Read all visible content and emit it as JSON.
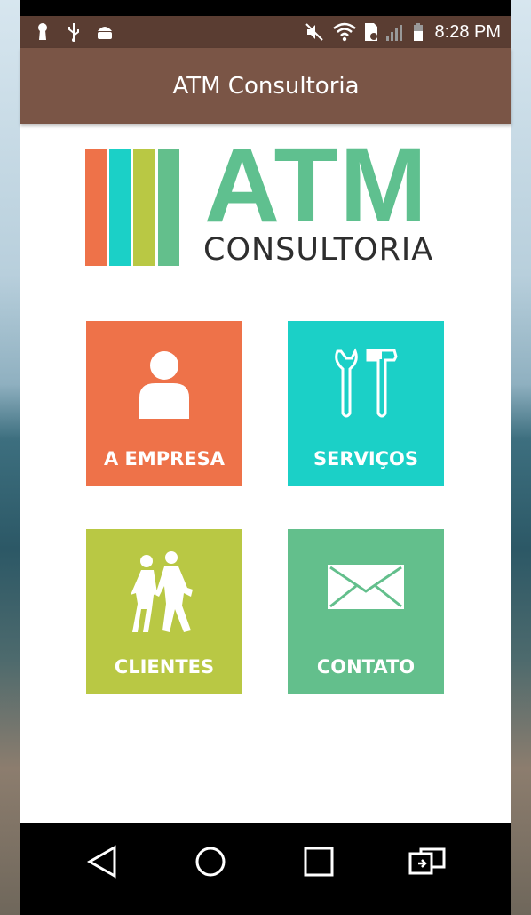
{
  "status_bar": {
    "time": "8:28 PM",
    "icons": [
      "keyhole-icon",
      "usb-icon",
      "android-debug-icon",
      "mute-icon",
      "wifi-icon",
      "sim-icon",
      "signal-icon",
      "battery-icon"
    ]
  },
  "app_bar": {
    "title": "ATM Consultoria"
  },
  "logo": {
    "main": "ATM",
    "sub": "CONSULTORIA",
    "stripe_colors": [
      "#ee7249",
      "#1bd0c7",
      "#b9c844",
      "#63bf8c"
    ]
  },
  "tiles": [
    {
      "label": "A EMPRESA",
      "color": "#ee7249",
      "icon": "person-icon"
    },
    {
      "label": "SERVIÇOS",
      "color": "#1bd0c7",
      "icon": "tools-icon"
    },
    {
      "label": "CLIENTES",
      "color": "#b9c844",
      "icon": "walking-people-icon"
    },
    {
      "label": "CONTATO",
      "color": "#63bf8c",
      "icon": "envelope-icon"
    }
  ],
  "nav_bar": {
    "buttons": [
      "back-icon",
      "home-icon",
      "recents-icon",
      "switch-app-icon"
    ]
  }
}
